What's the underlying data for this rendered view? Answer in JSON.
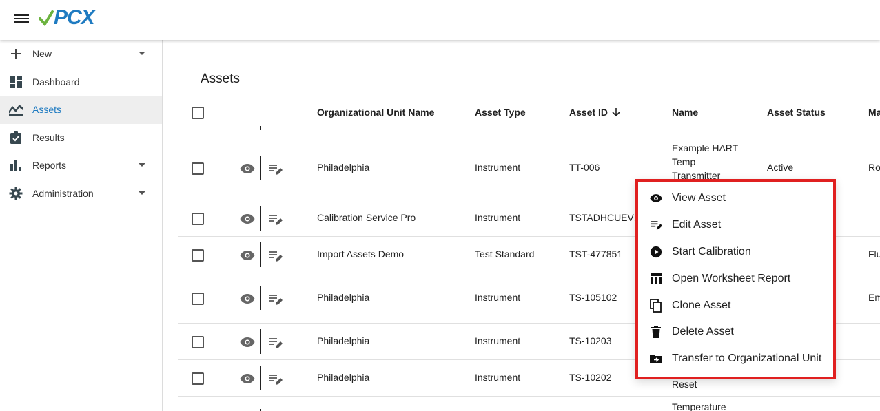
{
  "app": {
    "logo_text": "PCX",
    "brand_color": "#1f7bc1",
    "accent_red": "#e02020"
  },
  "sidebar": {
    "items": [
      {
        "label": "New",
        "icon": "plus-icon",
        "has_caret": true
      },
      {
        "label": "Dashboard",
        "icon": "dashboard-icon",
        "has_caret": false
      },
      {
        "label": "Assets",
        "icon": "assets-icon",
        "has_caret": false,
        "active": true
      },
      {
        "label": "Results",
        "icon": "clipboard-check-icon",
        "has_caret": false
      },
      {
        "label": "Reports",
        "icon": "bar-chart-icon",
        "has_caret": true
      },
      {
        "label": "Administration",
        "icon": "gear-icon",
        "has_caret": true
      }
    ]
  },
  "main": {
    "title": "Assets",
    "columns": [
      "Organizational Unit Name",
      "Asset Type",
      "Asset ID",
      "Name",
      "Asset Status",
      "Ma"
    ],
    "rows": [
      {
        "org": "Philadelphia",
        "type": "Instrument",
        "id": "TT-006",
        "name": "Example HART Temp Transmitter",
        "name_lines": [
          "Example HART",
          "Temp",
          "Transmitter"
        ],
        "status": "Active",
        "extra": "Ro"
      },
      {
        "org": "Calibration Service Pro",
        "type": "Instrument",
        "id": "TSTADHCUEV1",
        "name": "",
        "status": "",
        "extra": ""
      },
      {
        "org": "Import Assets Demo",
        "type": "Test Standard",
        "id": "TST-477851",
        "name": "",
        "status": "",
        "extra": "Flu"
      },
      {
        "org": "Philadelphia",
        "type": "Instrument",
        "id": "TS-105102",
        "name": "",
        "status": "",
        "extra": "Em"
      },
      {
        "org": "Philadelphia",
        "type": "Instrument",
        "id": "TS-10203",
        "name": "",
        "status": "",
        "extra": ""
      },
      {
        "org": "Philadelphia",
        "type": "Instrument",
        "id": "TS-10202",
        "name": "Reset",
        "status": "",
        "extra": ""
      },
      {
        "org": "",
        "type": "",
        "id": "",
        "name": "Temperature",
        "status": "",
        "extra": ""
      }
    ]
  },
  "context_menu": {
    "items": [
      {
        "label": "View Asset",
        "icon": "eye-icon"
      },
      {
        "label": "Edit Asset",
        "icon": "edit-icon"
      },
      {
        "label": "Start Calibration",
        "icon": "play-circle-icon"
      },
      {
        "label": "Open Worksheet Report",
        "icon": "table-icon"
      },
      {
        "label": "Clone Asset",
        "icon": "copy-icon"
      },
      {
        "label": "Delete Asset",
        "icon": "trash-icon"
      },
      {
        "label": "Transfer to Organizational Unit",
        "icon": "folder-move-icon"
      }
    ]
  }
}
